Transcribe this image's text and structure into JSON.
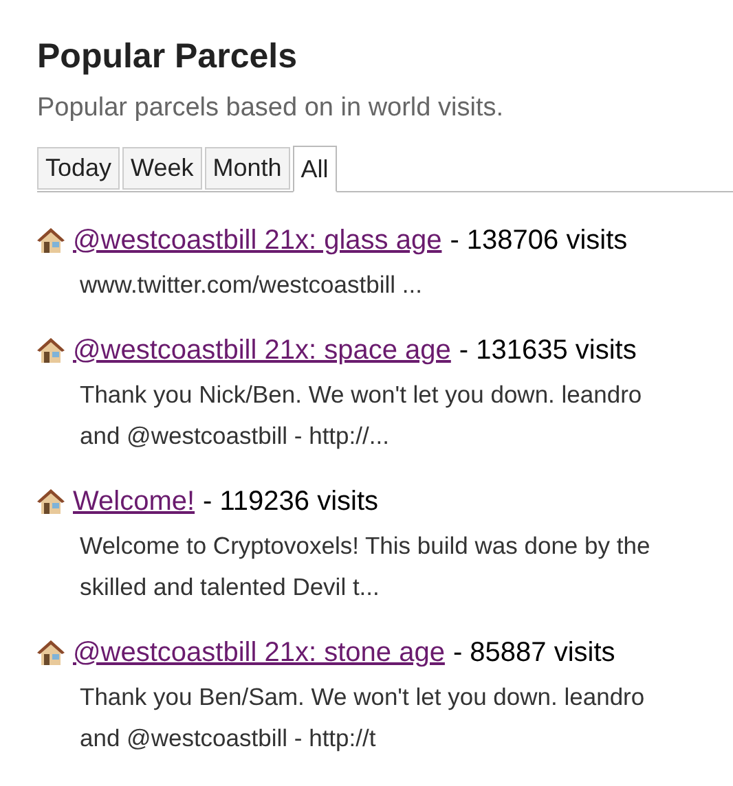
{
  "title": "Popular Parcels",
  "subtitle": "Popular parcels based on in world visits.",
  "tabs": [
    {
      "label": "Today",
      "selected": false
    },
    {
      "label": "Week",
      "selected": false
    },
    {
      "label": "Month",
      "selected": false
    },
    {
      "label": "All",
      "selected": true
    }
  ],
  "parcels": [
    {
      "name": "@westcoastbill 21x: glass age",
      "visits": "- 138706 visits",
      "description": "www.twitter.com/westcoastbill ..."
    },
    {
      "name": "@westcoastbill 21x: space age",
      "visits": "- 131635 visits",
      "description": "Thank you Nick/Ben. We won't let you down. leandro and @westcoastbill - http://..."
    },
    {
      "name": "Welcome!",
      "visits": "- 119236 visits",
      "description": "Welcome to Cryptovoxels! This build was done by the skilled and talented Devil t..."
    },
    {
      "name": "@westcoastbill 21x: stone age",
      "visits": "- 85887 visits",
      "description": "Thank you Ben/Sam. We won't let you down. leandro and @westcoastbill - http://t"
    }
  ]
}
